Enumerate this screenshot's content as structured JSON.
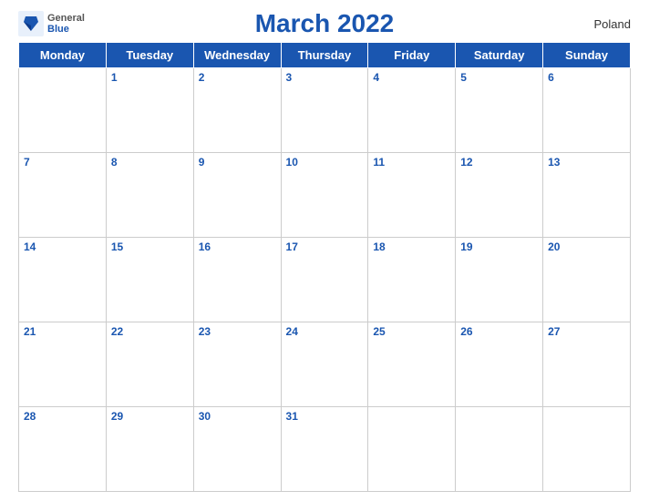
{
  "logo": {
    "general": "General",
    "blue": "Blue"
  },
  "title": "March 2022",
  "country": "Poland",
  "weekdays": [
    "Monday",
    "Tuesday",
    "Wednesday",
    "Thursday",
    "Friday",
    "Saturday",
    "Sunday"
  ],
  "weeks": [
    [
      null,
      1,
      2,
      3,
      4,
      5,
      6
    ],
    [
      7,
      8,
      9,
      10,
      11,
      12,
      13
    ],
    [
      14,
      15,
      16,
      17,
      18,
      19,
      20
    ],
    [
      21,
      22,
      23,
      24,
      25,
      26,
      27
    ],
    [
      28,
      29,
      30,
      31,
      null,
      null,
      null
    ]
  ]
}
